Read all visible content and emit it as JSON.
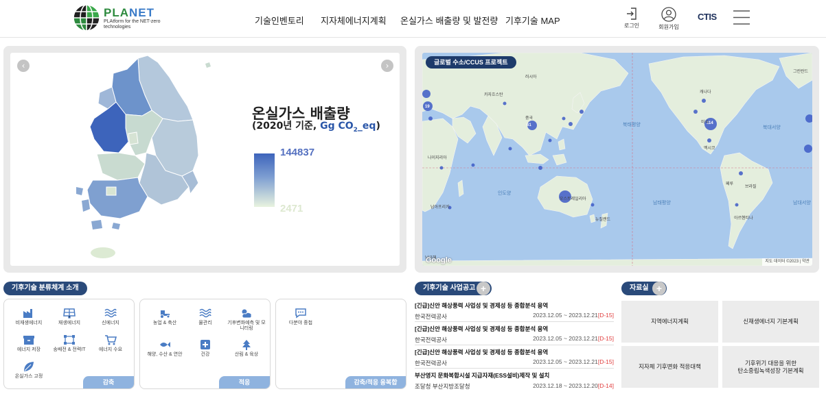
{
  "header": {
    "logo_name_a": "PLA",
    "logo_name_b": "NET",
    "logo_tagline": "PLAtform for the NET-zero technologies",
    "nav": [
      "기술인벤토리",
      "지자체에너지계획",
      "온실가스 배출량 및 발전량",
      "기후기술 MAP"
    ],
    "login": "로그인",
    "signup": "회원가입",
    "ctis": "CTIS"
  },
  "ghg": {
    "title": "온실가스 배출량",
    "subtitle_prefix": "(2020년 기준, ",
    "unit_a": "Gg CO",
    "unit_sub": "2",
    "unit_b": "_eq",
    "subtitle_suffix": ")",
    "max": "144837",
    "min": "2471",
    "colors": {
      "high": "#3d64bb",
      "mid": "#9bb4d6",
      "low": "#e8f3df"
    }
  },
  "global_map": {
    "label": "글로벌 수소/CCUS 프로젝트",
    "labels": [
      "북태평양",
      "북대서양",
      "인도양",
      "남태평양",
      "남대서양",
      "오스트레일리아",
      "캐나다",
      "미국",
      "브라질",
      "중국",
      "러시아",
      "멕시코",
      "페루",
      "아르헨티나",
      "남극해",
      "뉴질랜드",
      "카자흐스탄",
      "그린란드",
      "나이지리아",
      "남아프리카"
    ],
    "cluster_values": [
      "61",
      "114",
      "19"
    ],
    "google": "Google",
    "map_data": "지도 데이터 ©2023",
    "terms": "약관"
  },
  "classification": {
    "title": "기후기술 분류체계 소개",
    "groups": [
      {
        "tag": "감축",
        "items": [
          "비재생에너지",
          "재생에너지",
          "신에너지",
          "에너지 저장",
          "송배전 & 전력IT",
          "에너지 수요",
          "온실가스 고정"
        ]
      },
      {
        "tag": "적응",
        "items": [
          "농업 & 축산",
          "물관리",
          "기후변화예측 및 모니터링",
          "해양, 수산 & 연안",
          "건강",
          "산림 & 육상"
        ]
      },
      {
        "tag": "감축/적응 융복합",
        "items": [
          "다분야 중첩"
        ]
      }
    ]
  },
  "notices": {
    "title": "기후기술 사업공고",
    "plus": "+",
    "items": [
      {
        "title": "[긴급]신안 해상풍력 사업성 및 경제성 등 종합분석 용역",
        "org": "한국전력공사",
        "date": "2023.12.05 ~ 2023.12.21",
        "dday": "[D-15]"
      },
      {
        "title": "[긴급]신안 해상풍력 사업성 및 경제성 등 종합분석 용역",
        "org": "한국전력공사",
        "date": "2023.12.05 ~ 2023.12.21",
        "dday": "[D-15]"
      },
      {
        "title": "[긴급]신안 해상풍력 사업성 및 경제성 등 종합분석 용역",
        "org": "한국전력공사",
        "date": "2023.12.05 ~ 2023.12.21",
        "dday": "[D-15]"
      },
      {
        "title": "부산영지 문화복합시설 지급자재(ESS설비)제작 및 설치",
        "org": "조달청 부산지방조달청",
        "date": "2023.12.18 ~ 2023.12.20",
        "dday": "[D-14]"
      }
    ]
  },
  "library": {
    "title": "자료실",
    "plus": "+",
    "items": [
      "지역에너지계획",
      "신재생에너지 기본계획",
      "지자체 기후변화 적응대책",
      "기후위기 대응을 위한\n탄소중립녹색성장 기본계획"
    ]
  }
}
